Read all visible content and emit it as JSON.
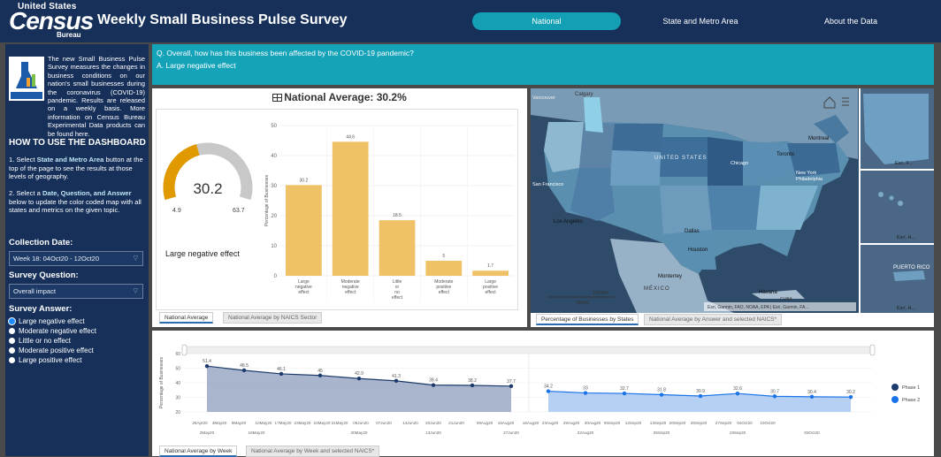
{
  "header": {
    "logo_top": "United States",
    "logo_main": "Census",
    "logo_sub": "Bureau",
    "title": "Weekly Small Business Pulse Survey",
    "nav": [
      {
        "label": "National",
        "active": true
      },
      {
        "label": "State and Metro Area",
        "active": false
      },
      {
        "label": "About the Data",
        "active": false
      }
    ]
  },
  "sidebar": {
    "badge_text": "EXPERIMENTAL DATA",
    "intro": "The new Small Business Pulse Survey measures the changes in business conditions on our nation's small businesses during the coronavirus (COVID-19) pandemic. Results are released on a weekly basis. More information on Census Bureau Experimental Data products can be found here.",
    "how_to_title": "HOW TO USE THE DASHBOARD",
    "step1_pre": "1. Select ",
    "step1_link": "State and Metro Area",
    "step1_post": " button at the top of the page to see the results at those levels of geography.",
    "step2_pre": "2. Select a ",
    "step2_link": "Date, Question, and Answer",
    "step2_post": " below to update the color coded map with all states and metrics on the given topic.",
    "date_label": "Collection Date:",
    "date_value": "Week 18: 04Oct20 - 12Oct20",
    "question_label": "Survey Question:",
    "question_value": "Overall impact",
    "answer_label": "Survey Answer:",
    "answers": [
      {
        "label": "Large negative effect",
        "selected": true
      },
      {
        "label": "Moderate negative effect",
        "selected": false
      },
      {
        "label": "Little or no effect",
        "selected": false
      },
      {
        "label": "Moderate positive effect",
        "selected": false
      },
      {
        "label": "Large positive effect",
        "selected": false
      }
    ]
  },
  "question": {
    "q": "Q. Overall, how has this business been affected by the COVID-19 pandemic?",
    "a": "A. Large negative effect"
  },
  "national_average": {
    "label": "National Average: 30.2%"
  },
  "gauge": {
    "value": 30.2,
    "value_text": "30.2",
    "min": 4.9,
    "min_text": "4.9",
    "max": 63.7,
    "max_text": "63.7",
    "caption": "Large negative effect",
    "fill_color": "#e09a00",
    "track_color": "#c8c8c8"
  },
  "chart_data": [
    {
      "type": "bar",
      "categories": [
        "Large negative effect",
        "Moderate negative effect",
        "Little or no effect",
        "Moderate positive effect",
        "Large positive effect"
      ],
      "category_lines": [
        [
          "Large",
          "negative",
          "effect"
        ],
        [
          "Moderate",
          "negative",
          "effect"
        ],
        [
          "Little",
          "or",
          "no",
          "effect"
        ],
        [
          "Moderate",
          "positive",
          "effect"
        ],
        [
          "Large",
          "positive",
          "effect"
        ]
      ],
      "values": [
        30.2,
        44.6,
        18.5,
        5,
        1.7
      ],
      "labels": [
        "30.2",
        "44.6",
        "18.5",
        "5",
        "1.7"
      ],
      "ylabel": "Percentage of Businesses",
      "ylim": [
        0,
        50
      ],
      "yticks": [
        0,
        10,
        20,
        30,
        40,
        50
      ],
      "color": "#f0c268",
      "grid": true
    },
    {
      "type": "area",
      "ylabel": "Percentage of Businesses",
      "ylim": [
        20,
        60
      ],
      "yticks": [
        20,
        30,
        40,
        50,
        60
      ],
      "legend": [
        "Phase 1",
        "Phase 2"
      ],
      "legend_position": "right",
      "series": [
        {
          "name": "Phase 1",
          "color": "#1c3a6b",
          "x": [
            "26Apr20",
            "03May20",
            "10May20",
            "17May20",
            "24May20",
            "31May20",
            "07Jun20",
            "14Jun20",
            "21Jun20",
            "27Jun20"
          ],
          "values": [
            51.4,
            48.5,
            46.1,
            45,
            42.9,
            41.3,
            38.4,
            38.2,
            37.7,
            null
          ],
          "labels": [
            "51.4",
            "48.5",
            "46.1",
            "45",
            "42.9",
            "41.3",
            "38.4",
            "38.2",
            "37.7",
            ""
          ]
        },
        {
          "name": "Phase 2",
          "color": "#1a73e8",
          "x": [
            "09Aug20",
            "16Aug20",
            "23Aug20",
            "30Aug20",
            "06Sep20",
            "13Sep20",
            "20Sep20",
            "27Sep20",
            "04Oct20"
          ],
          "values": [
            34.2,
            33,
            32.7,
            31.8,
            30.9,
            32.6,
            30.7,
            30.4,
            30.2
          ],
          "labels": [
            "34.2",
            "33",
            "32.7",
            "31.8",
            "30.9",
            "32.6",
            "30.7",
            "30.4",
            "30.2"
          ]
        }
      ],
      "xticks_row1": [
        "26Apr20",
        "3May20",
        "9May20",
        "10May20",
        "17May20",
        "23May20",
        "24May20",
        "31May20",
        "06Jun20",
        "07Jun20",
        "14Jun20",
        "20Jun20",
        "21Jun20",
        "09Aug20",
        "15Aug20",
        "16Aug20",
        "23Aug20",
        "29Aug20",
        "30Aug20",
        "06Sep20",
        "12Sep20",
        "13Sep20",
        "20Sep20",
        "26Sep20",
        "27Sep20",
        "04Oct20",
        "10Oct20"
      ],
      "xticks_row2": [
        "2May20",
        "16May20",
        "30May20",
        "13Jun20",
        "27Jun20",
        "22Aug20",
        "05Sep20",
        "19Sep20",
        "03Oct20"
      ]
    }
  ],
  "map": {
    "labels": [
      "Calgary",
      "Vancouver",
      "Montreal",
      "Toronto",
      "Chicago",
      "UNITED STATES",
      "New York",
      "Philadelphia",
      "San Francisco",
      "Los Angeles",
      "Dallas",
      "Houston",
      "Monterrey",
      "MÉXICO",
      "Havana",
      "CUBA"
    ],
    "scale_km": "1000km",
    "scale_mi": "600mi",
    "attribution": "Esri, Garmin, FAO, NOAA, EPA | Esri, Garmin, FA...",
    "inset_labels": [
      "Esri, F...",
      "Esri, H...",
      "PUERTO RICO",
      "Esri, H..."
    ],
    "home_icon": "home-icon",
    "legend_icon": "list-icon"
  },
  "tabs": {
    "left": [
      "National Average",
      "National Average by NAICS Sector"
    ],
    "map": [
      "Percentage of Businesses by States",
      "National Average by Answer and selected NAICS*"
    ],
    "bottom": [
      "National Average by Week",
      "National Average by Week and selected NAICS*"
    ]
  }
}
